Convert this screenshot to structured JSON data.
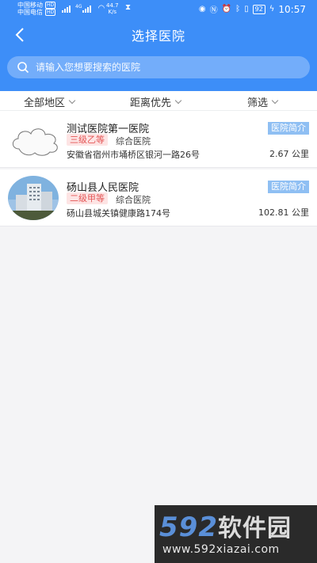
{
  "status_bar": {
    "carrier1": "中国移动",
    "carrier2": "中国电信",
    "hd": "HD",
    "net": "4G",
    "speed_value": "44.7",
    "speed_unit": "K/s",
    "battery": "92",
    "time": "10:57"
  },
  "nav": {
    "title": "选择医院"
  },
  "search": {
    "placeholder": "请输入您想要搜索的医院"
  },
  "filters": {
    "region": "全部地区",
    "distance": "距离优先",
    "filter": "筛选"
  },
  "hospitals": [
    {
      "name": "测试医院第一医院",
      "grade": "三级乙等",
      "type": "综合医院",
      "address": "安徽省宿州市埇桥区银河一路26号",
      "intro": "医院简介",
      "distance": "2.67 公里"
    },
    {
      "name": "砀山县人民医院",
      "grade": "二级甲等",
      "type": "综合医院",
      "address": "砀山县城关镇健康路174号",
      "intro": "医院简介",
      "distance": "102.81 公里"
    }
  ],
  "watermark": {
    "brand": "592",
    "brand_cn": "软件园",
    "url": "www.592xiazai.com"
  },
  "colors": {
    "primary": "#3d8ef8",
    "grade_text": "#e45555",
    "intro_bg": "#8fbff3"
  }
}
